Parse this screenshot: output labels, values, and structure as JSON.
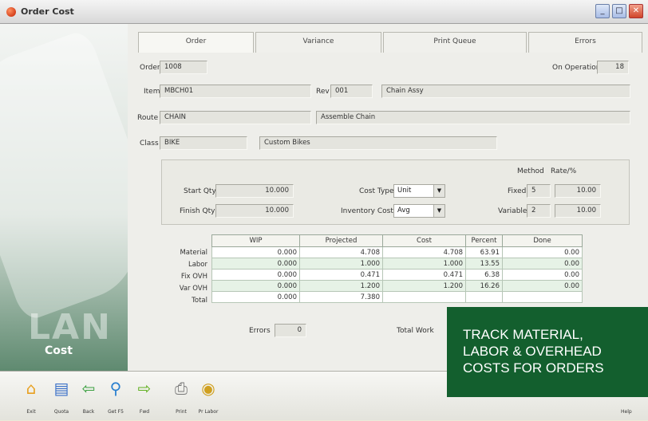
{
  "window": {
    "title": "Order Cost",
    "minimize": "_",
    "maximize": "□",
    "close": "✕"
  },
  "side": {
    "brand": "LAN",
    "label": "Cost"
  },
  "tabs": [
    "Order",
    "Variance",
    "Print Queue",
    "Errors"
  ],
  "header": {
    "order_label": "Order",
    "order_value": "1008",
    "on_operation_label": "On Operation",
    "on_operation_value": "18",
    "item_label": "Item",
    "item_value": "MBCH01",
    "rev_label": "Rev",
    "rev_value": "001",
    "item_desc": "Chain Assy",
    "route_label": "Route",
    "route_value": "CHAIN",
    "route_desc": "Assemble Chain",
    "class_label": "Class",
    "class_value": "BIKE",
    "class_desc": "Custom Bikes"
  },
  "params": {
    "start_qty_label": "Start Qty",
    "start_qty_value": "10.000",
    "finish_qty_label": "Finish Qty",
    "finish_qty_value": "10.000",
    "cost_type_label": "Cost Type",
    "cost_type_value": "Unit",
    "inventory_cost_label": "Inventory Cost",
    "inventory_cost_value": "Avg",
    "method_label": "Method",
    "rate_label": "Rate/%",
    "fixed_label": "Fixed",
    "fixed_method": "5",
    "fixed_rate": "10.00",
    "variable_label": "Variable",
    "variable_method": "2",
    "variable_rate": "10.00"
  },
  "grid": {
    "columns": [
      "WIP",
      "Projected",
      "Cost",
      "Percent",
      "Done"
    ],
    "rows": [
      {
        "label": "Material",
        "cells": [
          "0.000",
          "4.708",
          "4.708",
          "63.91",
          "0.00"
        ]
      },
      {
        "label": "Labor",
        "cells": [
          "0.000",
          "1.000",
          "1.000",
          "13.55",
          "0.00"
        ]
      },
      {
        "label": "Fix OVH",
        "cells": [
          "0.000",
          "0.471",
          "0.471",
          "6.38",
          "0.00"
        ]
      },
      {
        "label": "Var OVH",
        "cells": [
          "0.000",
          "1.200",
          "1.200",
          "16.26",
          "0.00"
        ]
      },
      {
        "label": "Total",
        "cells": [
          "0.000",
          "7.380",
          "",
          "",
          ""
        ]
      }
    ]
  },
  "footer": {
    "errors_label": "Errors",
    "errors_value": "0",
    "total_work_label": "Total Work"
  },
  "toolbar": [
    {
      "label": "Exit",
      "icon": "home-icon",
      "glyph": "⌂",
      "color": "#e8a020"
    },
    {
      "label": "Quota",
      "icon": "document-icon",
      "glyph": "▤",
      "color": "#3a70c8"
    },
    {
      "label": "Back",
      "icon": "back-arrow-icon",
      "glyph": "⇦",
      "color": "#3aa040"
    },
    {
      "label": "Get F5",
      "icon": "magnifier-icon",
      "glyph": "⚲",
      "color": "#2a80d0"
    },
    {
      "label": "Fwd",
      "icon": "forward-arrow-icon",
      "glyph": "⇨",
      "color": "#60b020"
    },
    {
      "label": "Print",
      "icon": "printer-icon",
      "glyph": "⎙",
      "color": "#777777"
    },
    {
      "label": "Pr Labor",
      "icon": "labor-icon",
      "glyph": "◉",
      "color": "#d0a020"
    }
  ],
  "help_label": "Help",
  "promo": {
    "lines": [
      "TRACK MATERIAL,",
      "LABOR & OVERHEAD",
      "COSTS FOR ORDERS"
    ]
  }
}
